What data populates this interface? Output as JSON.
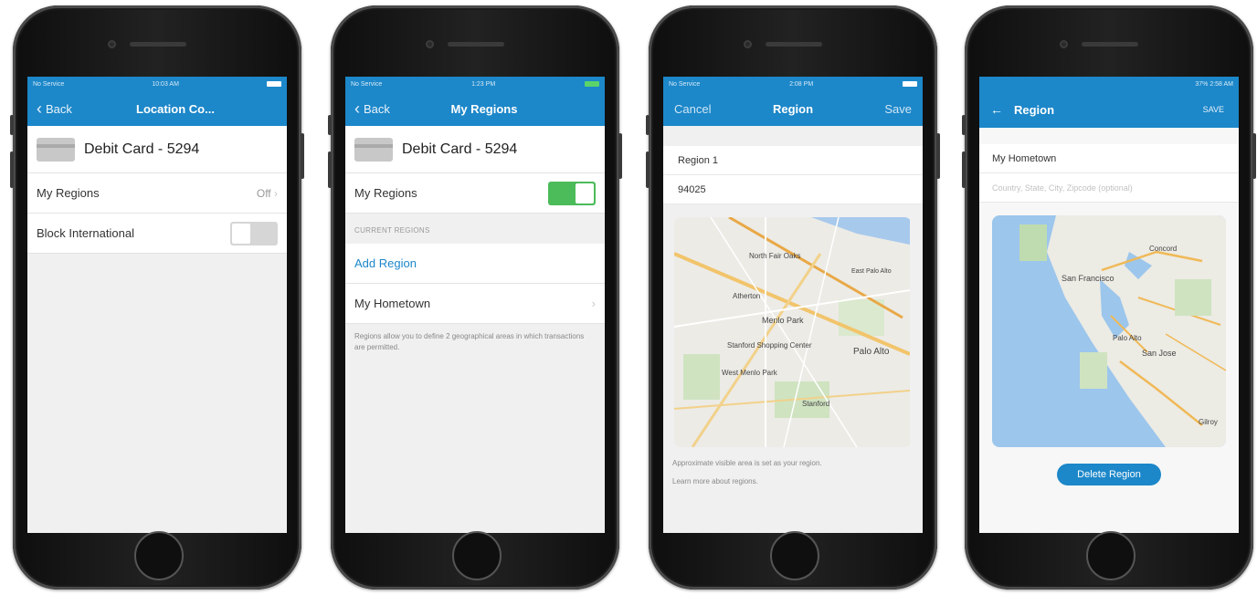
{
  "screen1": {
    "status_left": "No Service",
    "status_time": "10:03 AM",
    "back_label": "Back",
    "title": "Location Co...",
    "card_label": "Debit Card - 5294",
    "rows": [
      {
        "label": "My Regions",
        "value": "Off"
      },
      {
        "label": "Block International",
        "toggle": "off"
      }
    ]
  },
  "screen2": {
    "status_left": "No Service",
    "status_time": "1:23 PM",
    "back_label": "Back",
    "title": "My Regions",
    "card_label": "Debit Card - 5294",
    "my_regions_label": "My Regions",
    "my_regions_toggle": "on",
    "section_header": "CURRENT REGIONS",
    "add_region": "Add Region",
    "hometown": "My Hometown",
    "note": "Regions allow you to define 2 geographical areas in which transactions are permitted."
  },
  "screen3": {
    "status_left": "No Service",
    "status_time": "2:08 PM",
    "cancel": "Cancel",
    "title": "Region",
    "save": "Save",
    "region_name": "Region 1",
    "zip": "94025",
    "map_labels": [
      "North Fair Oaks",
      "Atherton",
      "Menlo Park",
      "Stanford Shopping Center",
      "West Menlo Park",
      "Palo Alto",
      "Stanford",
      "East Palo Alto"
    ],
    "note": "Approximate visible area is set as your region.",
    "learn_more": "Learn more about regions."
  },
  "screen4": {
    "status_right": "37% 2:58 AM",
    "title": "Region",
    "save": "SAVE",
    "name_value": "My Hometown",
    "placeholder": "Country, State, City, Zipcode (optional)",
    "map_labels": [
      "San Francisco",
      "Concord",
      "Palo Alto",
      "San Jose",
      "Gilroy"
    ],
    "delete_button": "Delete Region"
  },
  "colors": {
    "brand_blue": "#1c87c9",
    "toggle_on": "#4cbb5a"
  }
}
